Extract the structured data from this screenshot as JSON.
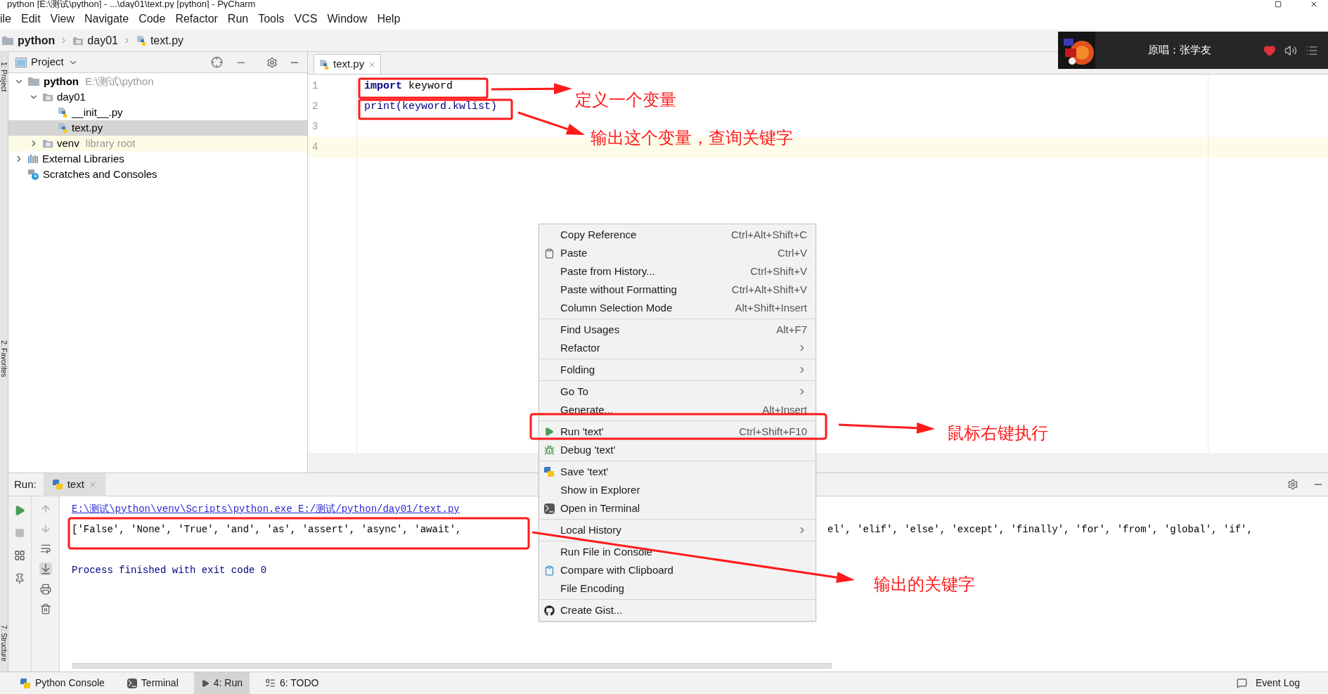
{
  "window": {
    "title": "python [E:\\测试\\python] - ...\\day01\\text.py [python] - PyCharm"
  },
  "menu_bar": [
    "ile",
    "Edit",
    "View",
    "Navigate",
    "Code",
    "Refactor",
    "Run",
    "Tools",
    "VCS",
    "Window",
    "Help"
  ],
  "breadcrumbs": [
    {
      "label": "python",
      "kind": "project"
    },
    {
      "label": "day01",
      "kind": "folder"
    },
    {
      "label": "text.py",
      "kind": "file"
    }
  ],
  "music_player": {
    "credit": "原唱：张学友",
    "liked": true
  },
  "side_strip": [
    "1: Project",
    "2: Favorites",
    "7: Structure"
  ],
  "project_panel": {
    "title": "Project",
    "tree": [
      {
        "label": "python",
        "hint": "E:\\测试\\python",
        "kind": "project",
        "expanded": true,
        "selected": false,
        "hovered": false,
        "children": [
          {
            "label": "day01",
            "kind": "folder",
            "expanded": true,
            "selected": false,
            "hovered": false,
            "children": [
              {
                "label": "__init__.py",
                "kind": "file",
                "selected": false,
                "hovered": false
              },
              {
                "label": "text.py",
                "kind": "file",
                "selected": true,
                "hovered": false
              }
            ]
          },
          {
            "label": "venv",
            "hint": "library root",
            "kind": "folder",
            "expanded": false,
            "selected": false,
            "hovered": true
          }
        ]
      },
      {
        "label": "External Libraries",
        "kind": "libraries",
        "expanded": false,
        "selected": false,
        "hovered": false
      },
      {
        "label": "Scratches and Consoles",
        "kind": "scratches",
        "selected": false,
        "hovered": false
      }
    ]
  },
  "editor": {
    "tabs": [
      {
        "label": "text.py",
        "selected": true
      }
    ],
    "lines": [
      {
        "number": "1",
        "current": false,
        "tokens": [
          {
            "text": "import",
            "kind": "keyword"
          },
          {
            "text": " keyword",
            "kind": "plain"
          }
        ]
      },
      {
        "number": "2",
        "current": false,
        "tokens": [
          {
            "text": "print(keyword.kwlist)",
            "kind": "builtin"
          }
        ]
      },
      {
        "number": "3",
        "current": false
      },
      {
        "number": "4",
        "current": true
      }
    ]
  },
  "context_menu": {
    "groups": [
      [
        {
          "label": "Copy Reference",
          "shortcut": "Ctrl+Alt+Shift+C",
          "submenu": false
        },
        {
          "label": "Paste",
          "shortcut": "Ctrl+V",
          "submenu": false
        },
        {
          "label": "Paste from History...",
          "shortcut": "Ctrl+Shift+V",
          "submenu": false
        },
        {
          "label": "Paste without Formatting",
          "shortcut": "Ctrl+Alt+Shift+V",
          "submenu": false
        },
        {
          "label": "Column Selection Mode",
          "shortcut": "Alt+Shift+Insert",
          "submenu": false
        }
      ],
      [
        {
          "label": "Find Usages",
          "shortcut": "Alt+F7",
          "submenu": false
        },
        {
          "label": "Refactor",
          "submenu": true
        }
      ],
      [
        {
          "label": "Folding",
          "submenu": true
        }
      ],
      [
        {
          "label": "Go To",
          "submenu": true
        },
        {
          "label": "Generate...",
          "shortcut": "Alt+Insert",
          "submenu": false
        }
      ],
      [
        {
          "label": "Run 'text'",
          "shortcut": "Ctrl+Shift+F10",
          "submenu": false
        },
        {
          "label": "Debug 'text'",
          "submenu": false
        }
      ],
      [
        {
          "label": "Save 'text'",
          "submenu": false
        },
        {
          "label": "Show in Explorer",
          "submenu": false
        },
        {
          "label": "Open in Terminal",
          "submenu": false
        }
      ],
      [
        {
          "label": "Local History",
          "submenu": true
        }
      ],
      [
        {
          "label": "Run File in Console",
          "submenu": false
        },
        {
          "label": "Compare with Clipboard",
          "submenu": false
        },
        {
          "label": "File Encoding",
          "submenu": false
        }
      ],
      [
        {
          "label": "Create Gist...",
          "submenu": false
        }
      ]
    ]
  },
  "run_panel": {
    "label": "Run:",
    "tabs": [
      {
        "label": "text",
        "selected": true
      }
    ],
    "output": [
      {
        "kind": "path",
        "text": "E:\\测试\\python\\venv\\Scripts\\python.exe E:/测试/python/day01/text.py"
      },
      {
        "kind": "result",
        "text": "['False', 'None', 'True', 'and', 'as', 'assert', 'async', 'await',",
        "text_end": "el', 'elif', 'else', 'except', 'finally', 'for', 'from', 'global', 'if',"
      },
      {
        "kind": "blank"
      },
      {
        "kind": "status",
        "text": "Process finished with exit code 0"
      }
    ]
  },
  "bottom_bar": {
    "tools": [
      {
        "label": "Python Console",
        "selected": false
      },
      {
        "label": "Terminal",
        "selected": false
      },
      {
        "label": "4: Run",
        "selected": true
      },
      {
        "label": "6: TODO",
        "selected": false
      }
    ],
    "event_log": "Event Log"
  },
  "annotations": [
    {
      "text": "定义一个变量"
    },
    {
      "text": "输出这个变量，查询关键字"
    },
    {
      "text": "鼠标右键执行"
    },
    {
      "text": "输出的关键字"
    }
  ]
}
